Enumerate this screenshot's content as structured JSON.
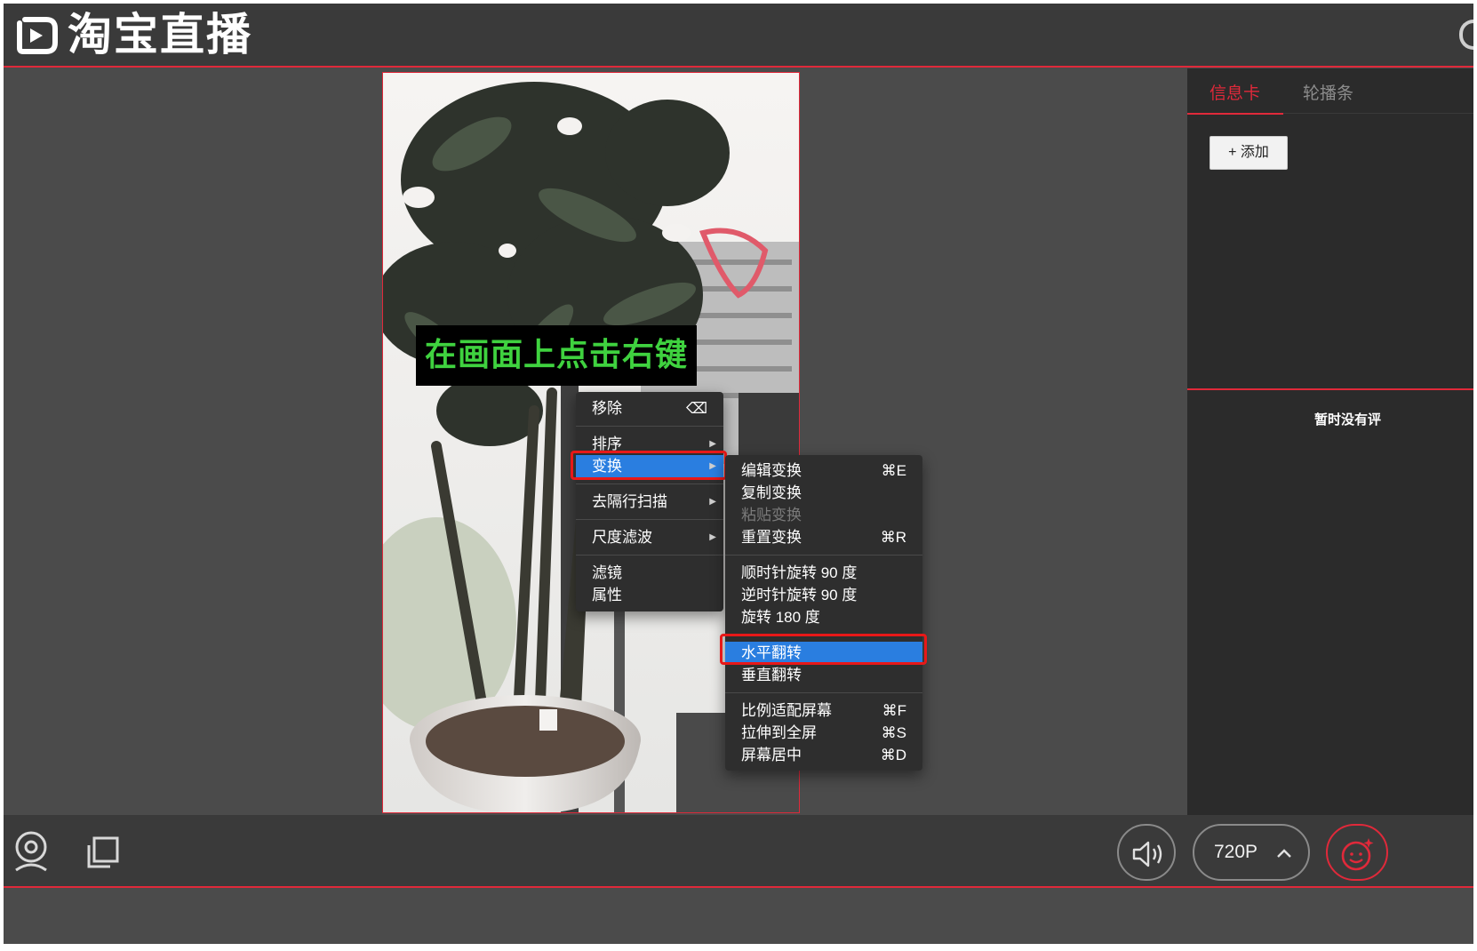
{
  "app": {
    "title": "淘宝直播"
  },
  "overlay_caption": "在画面上点击右键",
  "context_menu": {
    "items": [
      {
        "label": "移除",
        "shortcut": "⌫"
      },
      {
        "label": "排序",
        "submenu": true
      },
      {
        "label": "变换",
        "submenu": true,
        "highlighted": true
      },
      {
        "label": "去隔行扫描",
        "submenu": true
      },
      {
        "label": "尺度滤波",
        "submenu": true
      },
      {
        "label": "滤镜"
      },
      {
        "label": "属性"
      }
    ]
  },
  "transform_submenu": {
    "items": [
      {
        "label": "编辑变换",
        "shortcut": "⌘E"
      },
      {
        "label": "复制变换"
      },
      {
        "label": "粘贴变换",
        "disabled": true
      },
      {
        "label": "重置变换",
        "shortcut": "⌘R"
      },
      {
        "label": "顺时针旋转 90 度"
      },
      {
        "label": "逆时针旋转 90 度"
      },
      {
        "label": "旋转 180 度"
      },
      {
        "label": "水平翻转",
        "highlighted": true
      },
      {
        "label": "垂直翻转"
      },
      {
        "label": "比例适配屏幕",
        "shortcut": "⌘F"
      },
      {
        "label": "拉伸到全屏",
        "shortcut": "⌘S"
      },
      {
        "label": "屏幕居中",
        "shortcut": "⌘D"
      }
    ]
  },
  "sidebar": {
    "tabs": [
      {
        "label": "信息卡",
        "active": true
      },
      {
        "label": "轮播条",
        "active": false
      }
    ],
    "add_button": "+ 添加",
    "empty_text": "暂时没有评"
  },
  "bottom_bar": {
    "quality": "720P",
    "icons": [
      "camera-icon",
      "window-copy-icon",
      "speaker-icon",
      "chevron-up-icon",
      "beauty-face-icon"
    ]
  },
  "colors": {
    "accent": "#e0293a",
    "menu_highlight": "#2a7ee0",
    "caption_text": "#3fd23f",
    "annotation_box": "#e81818"
  }
}
